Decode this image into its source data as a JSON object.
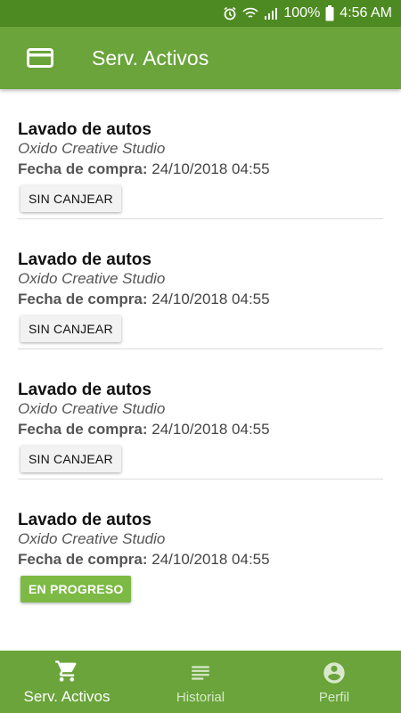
{
  "status_bar": {
    "battery": "100%",
    "time": "4:56 AM",
    "icons": [
      "alarm-icon",
      "wifi-icon",
      "signal-icon",
      "battery-icon"
    ]
  },
  "app_bar": {
    "title": "Serv. Activos",
    "icon": "credit-card-icon"
  },
  "services": [
    {
      "name": "Lavado de autos",
      "provider": "Oxido Creative Studio",
      "date_label": "Fecha de compra:",
      "date": "24/10/2018 04:55",
      "status": "SIN CANJEAR"
    },
    {
      "name": "Lavado de autos",
      "provider": "Oxido Creative Studio",
      "date_label": "Fecha de compra:",
      "date": "24/10/2018 04:55",
      "status": "SIN CANJEAR"
    },
    {
      "name": "Lavado de autos",
      "provider": "Oxido Creative Studio",
      "date_label": "Fecha de compra:",
      "date": "24/10/2018 04:55",
      "status": "SIN CANJEAR"
    },
    {
      "name": "Lavado de autos",
      "provider": "Oxido Creative Studio",
      "date_label": "Fecha de compra:",
      "date": "24/10/2018 04:55",
      "status": "EN PROGRESO"
    }
  ],
  "bottom_nav": [
    {
      "label": "Serv. Activos",
      "icon": "cart-icon",
      "active": true
    },
    {
      "label": "Historial",
      "icon": "list-icon",
      "active": false
    },
    {
      "label": "Perfil",
      "icon": "account-circle-icon",
      "active": false
    }
  ],
  "colors": {
    "status_bar": "#4e8a22",
    "primary": "#6aa43a",
    "progress_button": "#7cba45"
  }
}
